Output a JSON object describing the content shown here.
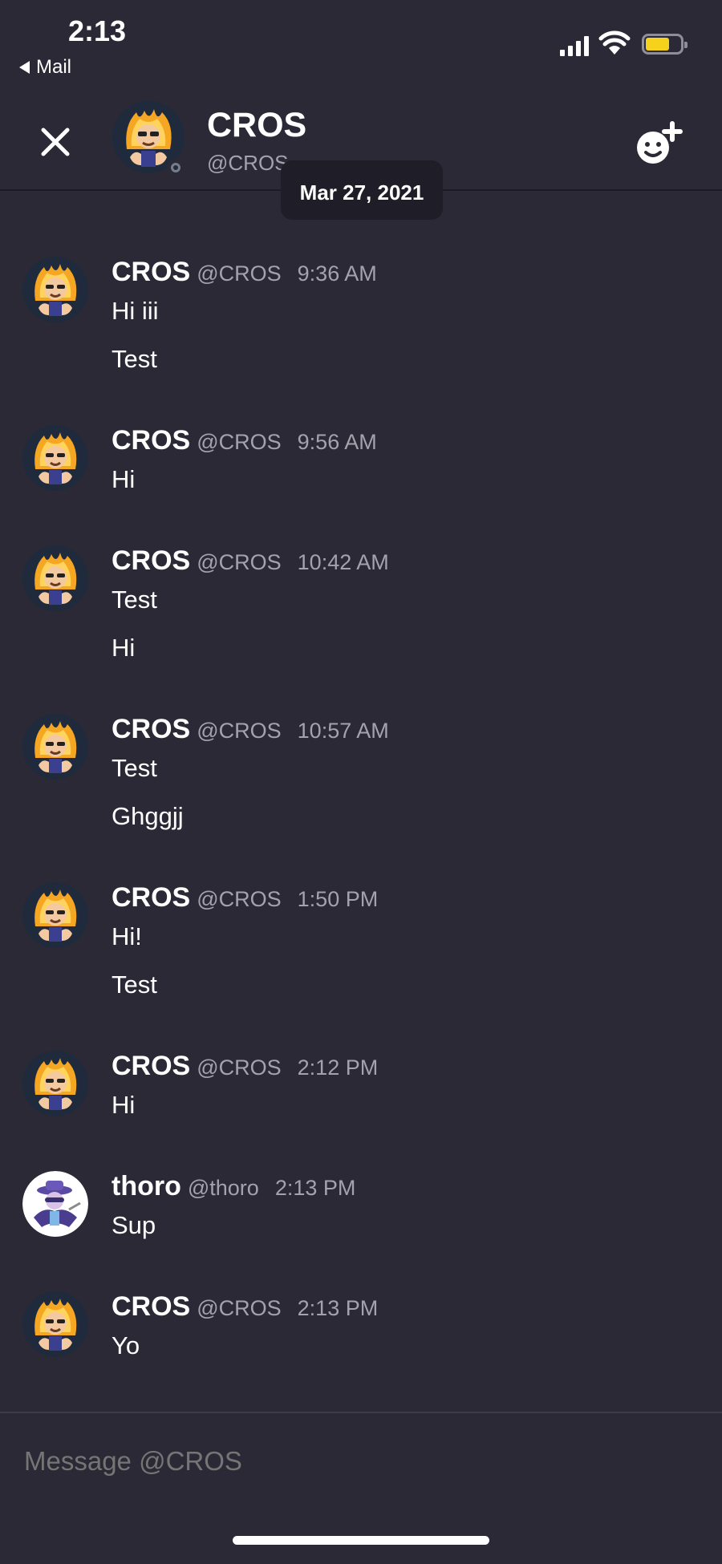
{
  "status_bar": {
    "time": "2:13",
    "back_app": "Mail",
    "battery_color": "#f7d21c"
  },
  "header": {
    "name": "CROS",
    "handle": "@CROS"
  },
  "date_divider": "Mar 27, 2021",
  "messages": [
    {
      "name": "CROS",
      "handle": "@CROS",
      "time": "9:36 AM",
      "lines": [
        "Hi iii",
        "Test"
      ]
    },
    {
      "name": "CROS",
      "handle": "@CROS",
      "time": "9:56 AM",
      "lines": [
        "Hi"
      ]
    },
    {
      "name": "CROS",
      "handle": "@CROS",
      "time": "10:42 AM",
      "lines": [
        "Test",
        "Hi"
      ]
    },
    {
      "name": "CROS",
      "handle": "@CROS",
      "time": "10:57 AM",
      "lines": [
        "Test",
        "Ghggjj"
      ]
    },
    {
      "name": "CROS",
      "handle": "@CROS",
      "time": "1:50 PM",
      "lines": [
        "Hi!",
        "Test"
      ]
    },
    {
      "name": "CROS",
      "handle": "@CROS",
      "time": "2:12 PM",
      "lines": [
        "Hi"
      ]
    },
    {
      "name": "thoro",
      "handle": "@thoro",
      "time": "2:13 PM",
      "lines": [
        "Sup"
      ]
    },
    {
      "name": "CROS",
      "handle": "@CROS",
      "time": "2:13 PM",
      "lines": [
        "Yo"
      ]
    }
  ],
  "composer": {
    "placeholder": "Message @CROS"
  }
}
